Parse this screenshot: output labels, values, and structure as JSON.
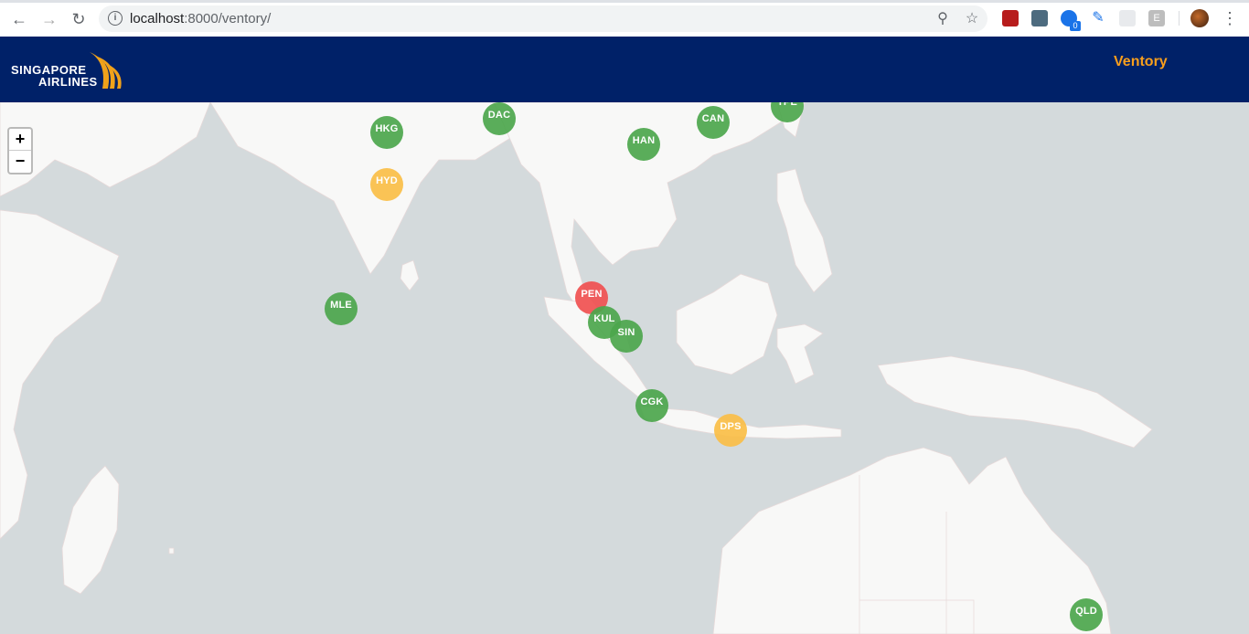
{
  "browser": {
    "url_host": "localhost",
    "url_path": ":8000/ventory/",
    "extension_badge": "0"
  },
  "header": {
    "logo_line1": "SINGAPORE",
    "logo_line2": "AIRLINES",
    "brand_link": "Ventory",
    "brand_color": "#f99f1c",
    "background_color": "#002168"
  },
  "map": {
    "zoom_in_label": "+",
    "zoom_out_label": "−",
    "status_colors": {
      "green": "#4ca64c",
      "orange": "#fabe46",
      "red": "#f05050"
    },
    "markers": [
      {
        "code": "HKG",
        "status": "green"
      },
      {
        "code": "DAC",
        "status": "green"
      },
      {
        "code": "HAN",
        "status": "green"
      },
      {
        "code": "CAN",
        "status": "green"
      },
      {
        "code": "TPE",
        "status": "green"
      },
      {
        "code": "HYD",
        "status": "orange"
      },
      {
        "code": "MLE",
        "status": "green"
      },
      {
        "code": "PEN",
        "status": "red"
      },
      {
        "code": "KUL",
        "status": "green"
      },
      {
        "code": "SIN",
        "status": "green"
      },
      {
        "code": "CGK",
        "status": "green"
      },
      {
        "code": "DPS",
        "status": "orange"
      },
      {
        "code": "QLD",
        "status": "green"
      }
    ]
  }
}
